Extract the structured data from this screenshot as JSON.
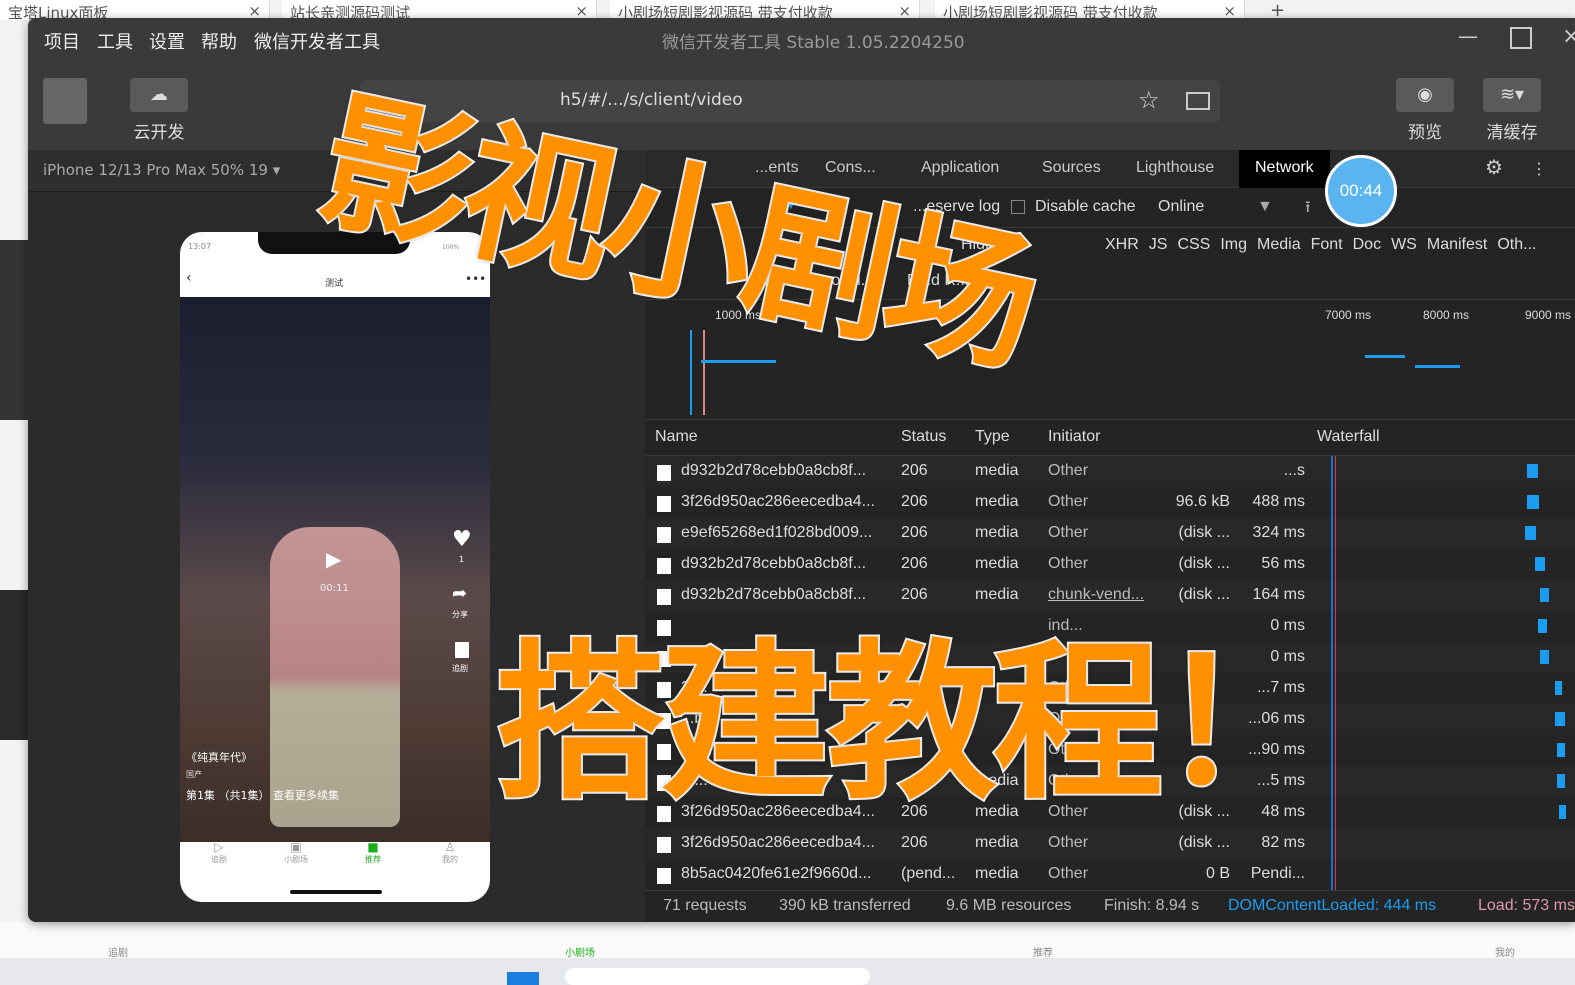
{
  "browser_tabs": [
    {
      "label": "宝塔Linux面板"
    },
    {
      "label": "站长亲测源码测试"
    },
    {
      "label": "小剧场短剧影视源码 带支付收款"
    },
    {
      "label": "小剧场短剧影视源码 带支付收款"
    }
  ],
  "menu": [
    "项目",
    "工具",
    "设置",
    "帮助",
    "微信开发者工具"
  ],
  "window_title": "微信开发者工具 Stable 1.05.2204250",
  "toolbar": {
    "cloud_label": "云开发",
    "address": "h5/#/.../s/client/video",
    "preview_label": "预览",
    "clear_cache_label": "清缓存"
  },
  "simulator": {
    "device": "iPhone 12/13 Pro Max 50% 19 ▾"
  },
  "phone": {
    "time": "13:07",
    "battery": "100%",
    "page_title": "测试",
    "video_time": "00:11",
    "like_count": "1",
    "share_label": "分享",
    "follow_label": "追剧",
    "show_title": "《纯真年代》",
    "region": "国产",
    "episode_info": "第1集 （共1集） 查看更多续集",
    "nav": [
      "追剧",
      "小剧场",
      "推荐",
      "我的"
    ],
    "active_color": "#1aad19"
  },
  "devtools": {
    "tabs": [
      "...ents",
      "Cons...",
      "Application",
      "Sources",
      "Lighthouse",
      "Network"
    ],
    "active_tab": "Network",
    "timer": "00:44",
    "toolbar": {
      "preserve_log": "...eserve log",
      "disable_cache": "Disable cache",
      "throttle": "Online"
    },
    "filters": [
      "Hide...",
      "XHR",
      "JS",
      "CSS",
      "Img",
      "Media",
      "Font",
      "Doc",
      "WS",
      "Manifest",
      "Oth..."
    ],
    "filter_row2": [
      "...cooki...",
      "B...d R..."
    ],
    "timeline_ticks": [
      "1000 ms",
      "7000 ms",
      "8000 ms",
      "9000 ms"
    ],
    "columns": [
      "Name",
      "Status",
      "Type",
      "Initiator",
      "Waterfall"
    ],
    "rows": [
      {
        "name": "d932b2d78cebb0a8cb8f...",
        "status": "206",
        "type": "media",
        "initiator": "Other",
        "size": "",
        "time": "...s"
      },
      {
        "name": "3f26d950ac286eecedba4...",
        "status": "206",
        "type": "media",
        "initiator": "Other",
        "size": "96.6 kB",
        "time": "488 ms"
      },
      {
        "name": "e9ef65268ed1f028bd009...",
        "status": "206",
        "type": "media",
        "initiator": "Other",
        "size": "(disk ...",
        "time": "324 ms"
      },
      {
        "name": "d932b2d78cebb0a8cb8f...",
        "status": "206",
        "type": "media",
        "initiator": "Other",
        "size": "(disk ...",
        "time": "56 ms"
      },
      {
        "name": "d932b2d78cebb0a8cb8f...",
        "status": "206",
        "type": "media",
        "initiator": "chunk-vend...",
        "size": "(disk ...",
        "time": "164 ms"
      },
      {
        "name": "",
        "status": "",
        "type": "",
        "initiator": "ind...",
        "size": "",
        "time": "0 ms"
      },
      {
        "name": "dat...",
        "status": "",
        "type": "",
        "initiator": "",
        "size": "",
        "time": "0 ms"
      },
      {
        "name": "3f...",
        "status": "",
        "type": "",
        "initiator": "Other",
        "size": "",
        "time": "...7 ms"
      },
      {
        "name": "...b...",
        "status": "",
        "type": "",
        "initiator": "Other",
        "size": "",
        "time": "...06 ms"
      },
      {
        "name": "3f2...",
        "status": "",
        "type": "",
        "initiator": "Other",
        "size": "",
        "time": "...90 ms"
      },
      {
        "name": "3f...",
        "status": "",
        "type": "media",
        "initiator": "Other",
        "size": "",
        "time": "...5 ms"
      },
      {
        "name": "3f26d950ac286eecedba4...",
        "status": "206",
        "type": "media",
        "initiator": "Other",
        "size": "(disk ...",
        "time": "48 ms"
      },
      {
        "name": "3f26d950ac286eecedba4...",
        "status": "206",
        "type": "media",
        "initiator": "Other",
        "size": "(disk ...",
        "time": "82 ms"
      },
      {
        "name": "8b5ac0420fe61e2f9660d...",
        "status": "(pend...",
        "type": "media",
        "initiator": "Other",
        "size": "0 B",
        "time": "Pendi..."
      }
    ],
    "summary": {
      "requests": "71 requests",
      "transferred": "390 kB transferred",
      "resources": "9.6 MB resources",
      "finish": "Finish: 8.94 s",
      "dom": "DOMContentLoaded: 444 ms",
      "load": "Load: 573 ms"
    },
    "dom_color": "#1a9df0"
  },
  "overlay": {
    "line1": "影视小剧场",
    "line2": "搭建教程！",
    "color": "#ff9000"
  },
  "page_nav": [
    "追剧",
    "小剧场",
    "推荐",
    "我的"
  ]
}
